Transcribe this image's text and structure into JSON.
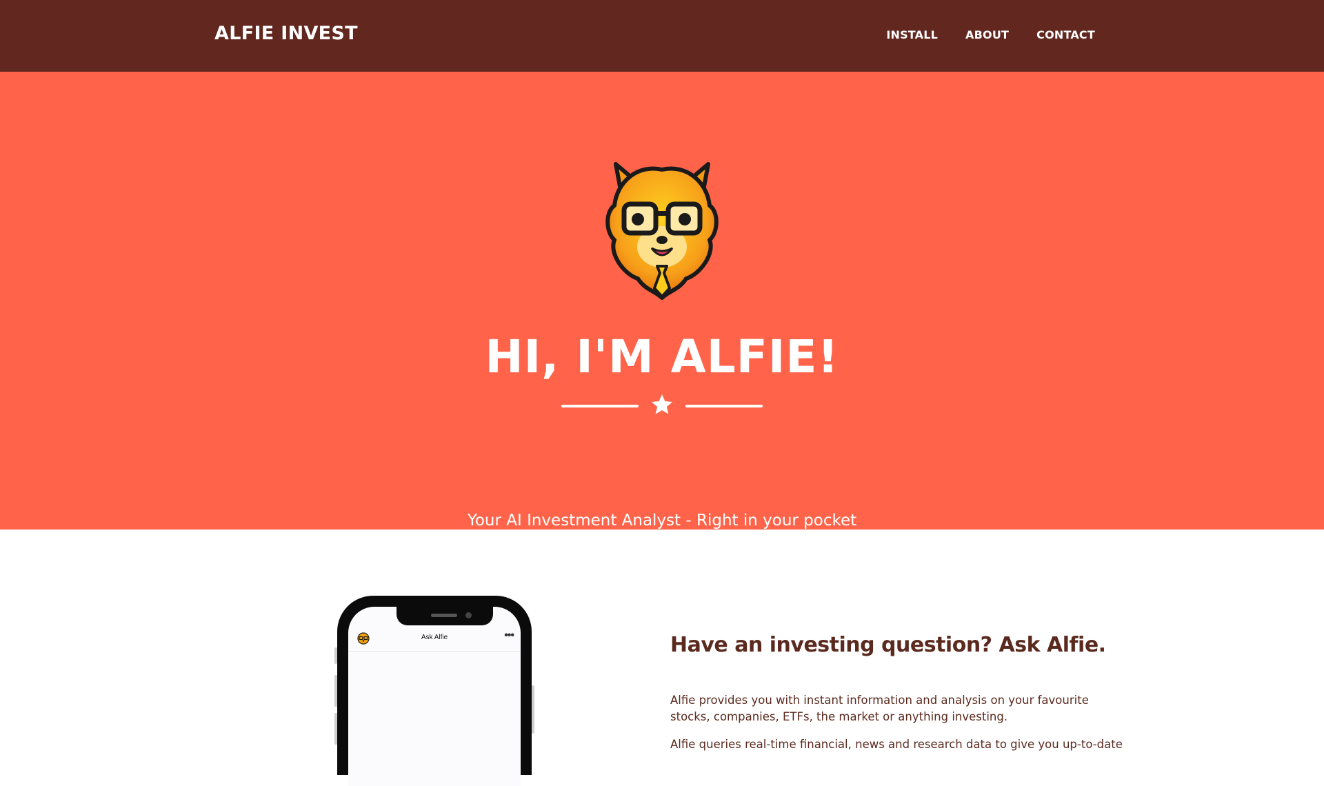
{
  "navbar": {
    "brand": "ALFIE INVEST",
    "links": [
      "INSTALL",
      "ABOUT",
      "CONTACT"
    ]
  },
  "hero": {
    "title": "HI, I'M ALFIE!",
    "subtitle": "Your AI Investment Analyst - Right in your pocket",
    "divider_icon": "star-icon",
    "mascot_icon": "dog-mascot-icon"
  },
  "phone": {
    "chat_title": "Ask Alfie",
    "menu_icon": "more-dots-icon"
  },
  "section": {
    "heading": "Have an investing question? Ask Alfie.",
    "paragraph1": "Alfie provides you with instant information and analysis on your favourite stocks, companies, ETFs, the market or anything investing.",
    "paragraph2": "Alfie queries real-time financial, news and research data to give you up-to-date"
  },
  "colors": {
    "navbar_bg": "#62281f",
    "hero_bg": "#ff644a",
    "text_brown": "#5b2a1f",
    "white": "#ffffff"
  }
}
